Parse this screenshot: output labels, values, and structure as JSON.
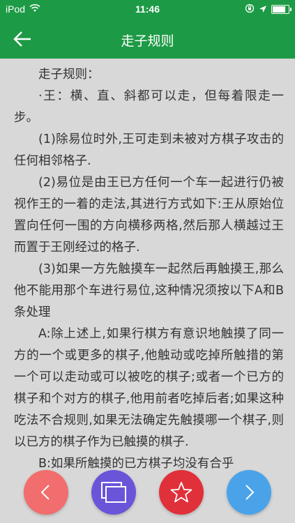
{
  "status_bar": {
    "carrier": "iPod",
    "time": "11:46",
    "battery_level": 0.9
  },
  "nav": {
    "title": "走子规则",
    "back_icon": "arrow-left-icon"
  },
  "content": {
    "paragraphs": [
      "走子规则：",
      "·王：横、直、斜都可以走，但每着限走一步。",
      "(1)除易位时外,王可走到未被对方棋子攻击的任何相邻格子.",
      "(2)易位是由王已方任何一个车一起进行仍被视作王的一着的走法,其进行方式如下:王从原始位置向任何一围的方向横移两格,然后那人横越过王而置于王刚经过的格子.",
      "(3)如果一方先触摸车一起然后再触摸王,那么他不能用那个车进行易位,这种情况须按以下A和B条处理",
      "A:除上述上,如果行棋方有意识地触摸了同一方的一个或更多的棋子,他触动或吃掉所触措的第一个可以走动或可以被吃的棋子;或者一个已方的棋子和个对方的棋子,他用前者吃掉后者;如果这种吃法不合规则,如果无法确定先触摸哪一个棋子,则以已方的棋子作为已触摸的棋子.",
      "B:如果所触摸的已方棋子均没有合乎"
    ]
  },
  "fabs": {
    "prev": {
      "icon": "chevron-left-icon",
      "color": "#f26d6d"
    },
    "pages": {
      "icon": "windows-icon",
      "color": "#6a55d9"
    },
    "favorite": {
      "icon": "star-icon",
      "color": "#e0303a"
    },
    "next": {
      "icon": "chevron-right-icon",
      "color": "#4aa3e8"
    }
  },
  "colors": {
    "header": "#1d9a45",
    "background": "#d8d8d8"
  }
}
